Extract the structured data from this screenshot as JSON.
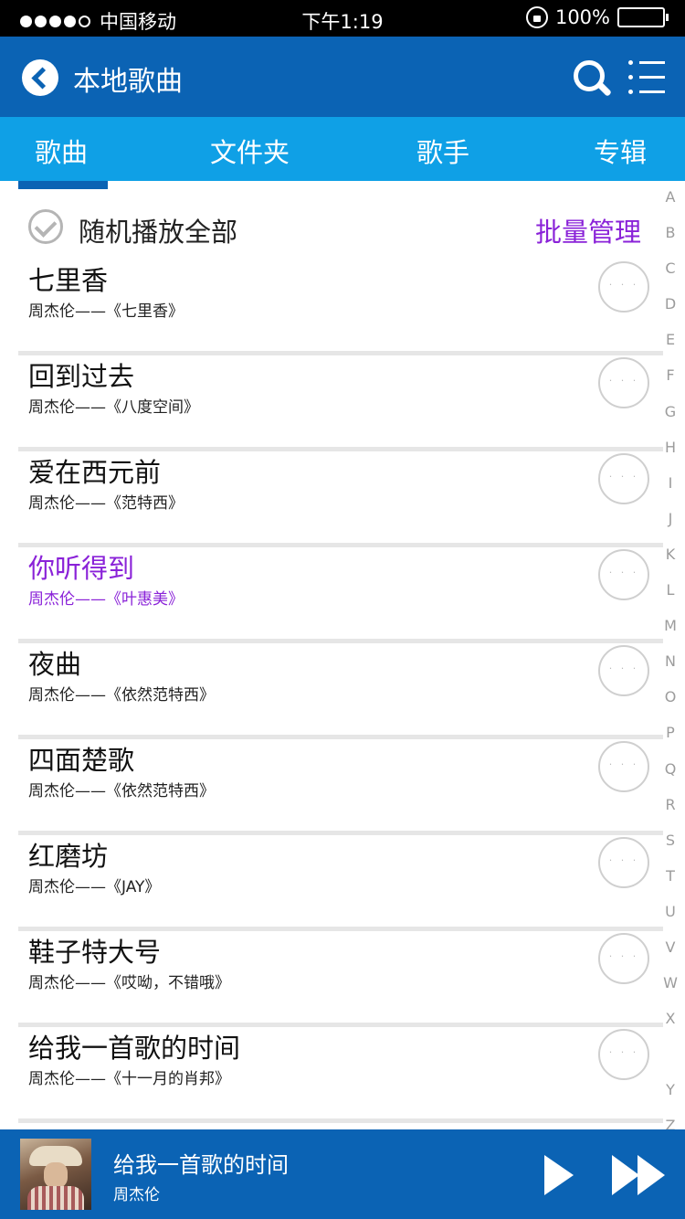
{
  "status_bar": {
    "carrier": "中国移动",
    "time": "下午1:19",
    "battery": "100%"
  },
  "header": {
    "title": "本地歌曲"
  },
  "tabs": [
    {
      "label": "歌曲",
      "active": true
    },
    {
      "label": "文件夹",
      "active": false
    },
    {
      "label": "歌手",
      "active": false
    },
    {
      "label": "专辑",
      "active": false
    }
  ],
  "shuffle": {
    "label": "随机播放全部",
    "batch_label": "批量管理"
  },
  "songs": [
    {
      "title": "七里香",
      "subtitle": "周杰伦——《七里香》",
      "active": false
    },
    {
      "title": "回到过去",
      "subtitle": "周杰伦——《八度空间》",
      "active": false
    },
    {
      "title": "爱在西元前",
      "subtitle": "周杰伦——《范特西》",
      "active": false
    },
    {
      "title": "你听得到",
      "subtitle": "周杰伦——《叶惠美》",
      "active": true
    },
    {
      "title": "夜曲",
      "subtitle": "周杰伦——《依然范特西》",
      "active": false
    },
    {
      "title": "四面楚歌",
      "subtitle": "周杰伦——《依然范特西》",
      "active": false
    },
    {
      "title": "红磨坊",
      "subtitle": "周杰伦——《JAY》",
      "active": false
    },
    {
      "title": "鞋子特大号",
      "subtitle": "周杰伦——《哎呦，不错哦》",
      "active": false
    },
    {
      "title": "给我一首歌的时间",
      "subtitle": "周杰伦——《十一月的肖邦》",
      "active": false
    }
  ],
  "more_glyph": "· · ·",
  "alphabet": [
    "A",
    "B",
    "C",
    "D",
    "E",
    "F",
    "G",
    "H",
    "I",
    "J",
    "K",
    "L",
    "M",
    "N",
    "O",
    "P",
    "Q",
    "R",
    "S",
    "T",
    "U",
    "V",
    "W",
    "X",
    "",
    "Y",
    "Z"
  ],
  "player": {
    "title": "给我一首歌的时间",
    "artist": "周杰伦"
  },
  "colors": {
    "header": "#0b63b4",
    "tabs": "#0fa0e6",
    "accent": "#8a22d8"
  }
}
